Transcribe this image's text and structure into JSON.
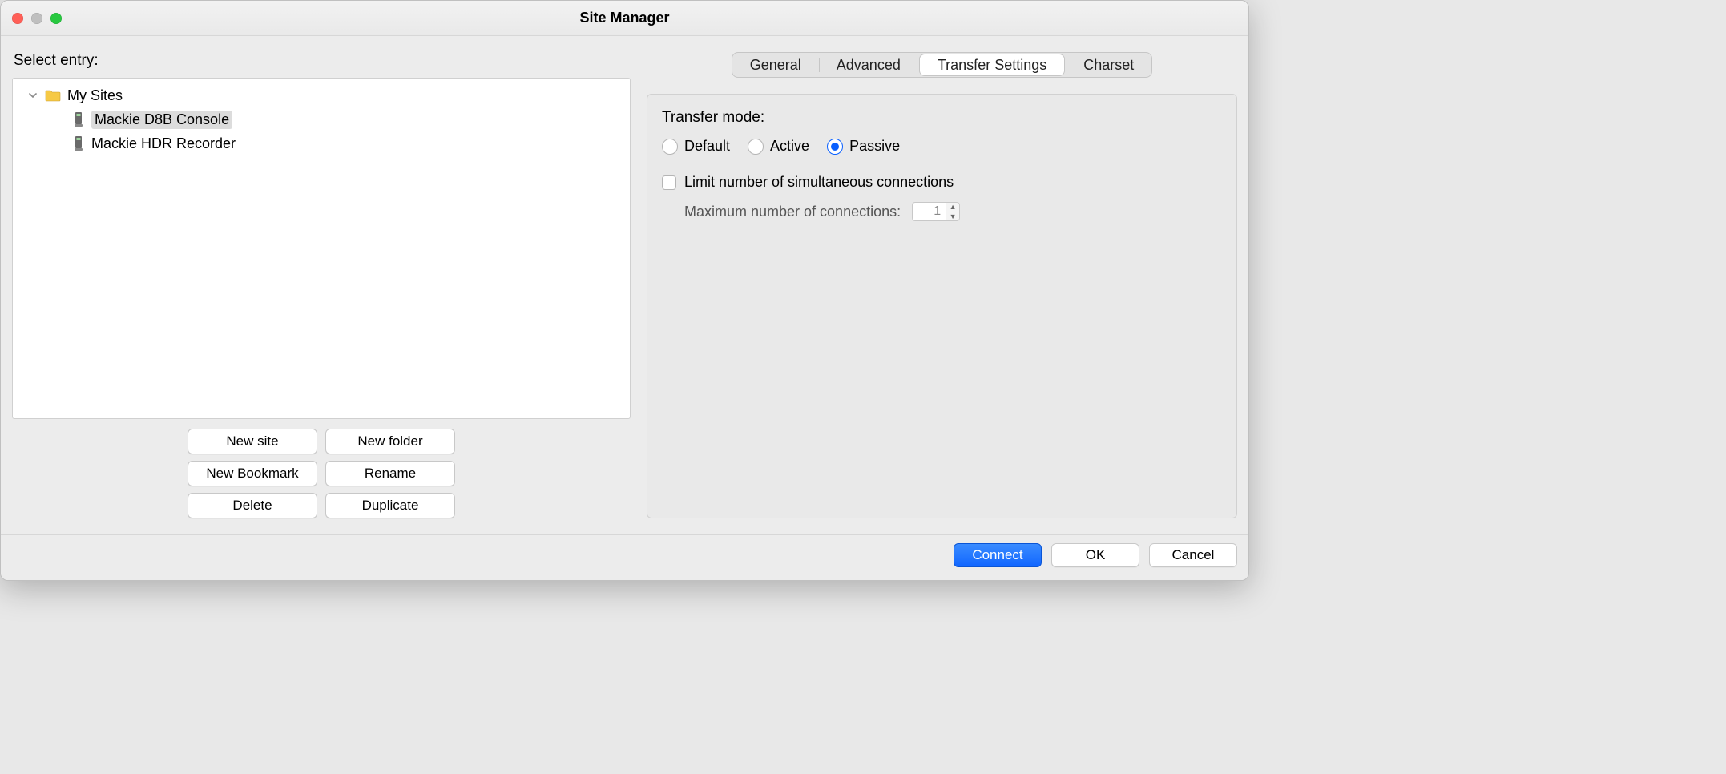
{
  "window": {
    "title": "Site Manager"
  },
  "left": {
    "label": "Select entry:",
    "tree": {
      "root_label": "My Sites",
      "items": [
        {
          "label": "Mackie D8B Console",
          "selected": true
        },
        {
          "label": "Mackie HDR Recorder",
          "selected": false
        }
      ]
    },
    "buttons": {
      "new_site": "New site",
      "new_folder": "New folder",
      "new_bookmark": "New Bookmark",
      "rename": "Rename",
      "delete": "Delete",
      "duplicate": "Duplicate"
    }
  },
  "tabs": {
    "general": "General",
    "advanced": "Advanced",
    "transfer_settings": "Transfer Settings",
    "charset": "Charset",
    "active": "transfer_settings"
  },
  "panel": {
    "transfer_mode_label": "Transfer mode:",
    "modes": {
      "default": "Default",
      "active": "Active",
      "passive": "Passive",
      "selected": "passive"
    },
    "limit_label": "Limit number of simultaneous connections",
    "limit_checked": false,
    "max_label": "Maximum number of connections:",
    "max_value": "1"
  },
  "footer": {
    "connect": "Connect",
    "ok": "OK",
    "cancel": "Cancel"
  }
}
